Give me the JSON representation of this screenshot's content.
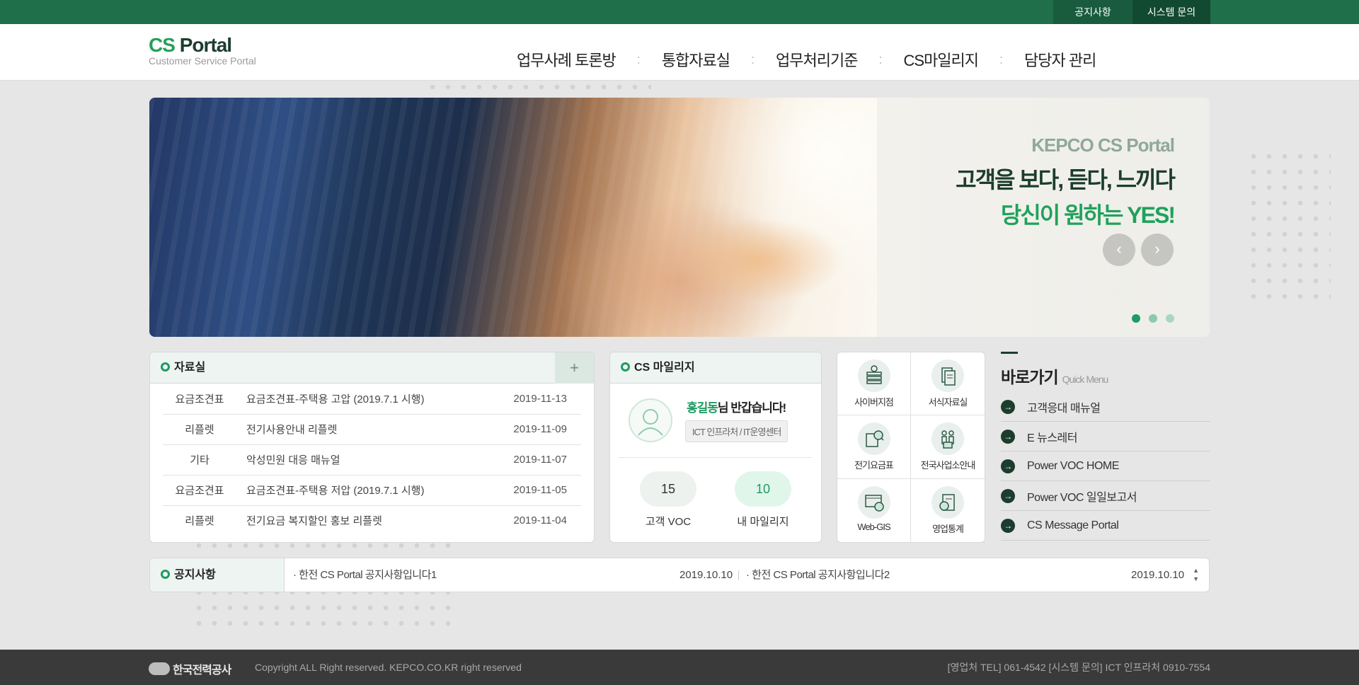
{
  "topbar": {
    "notice_link": "공지사항",
    "system_link": "시스템 문의"
  },
  "header": {
    "logo_cs": "CS",
    "logo_portal": "Portal",
    "logo_sub": "Customer Service Portal",
    "nav": [
      "업무사례 토론방",
      "통합자료실",
      "업무처리기준",
      "CS마일리지",
      "담당자 관리"
    ]
  },
  "hero": {
    "line1": "KEPCO CS Portal",
    "line2": "고객을 보다, 듣다, 느끼다",
    "line3": "당신이 원하는 YES!",
    "slide_count": 3,
    "active_slide": 1
  },
  "library": {
    "title": "자료실",
    "more": "+",
    "rows": [
      {
        "category": "요금조견표",
        "title": "요금조견표-주택용 고압 (2019.7.1 시행)",
        "date": "2019-11-13"
      },
      {
        "category": "리플렛",
        "title": "전기사용안내 리플렛",
        "date": "2019-11-09"
      },
      {
        "category": "기타",
        "title": "악성민원 대응 매뉴얼",
        "date": "2019-11-07"
      },
      {
        "category": "요금조견표",
        "title": "요금조견표-주택용 저압 (2019.7.1 시행)",
        "date": "2019-11-05"
      },
      {
        "category": "리플렛",
        "title": "전기요금 복지할인 홍보 리플렛",
        "date": "2019-11-04"
      }
    ]
  },
  "mileage": {
    "title": "CS 마일리지",
    "user_name": "홍길동",
    "greeting_suffix": "님 반갑습니다!",
    "dept": "ICT 인프라처 / IT운영센터",
    "voc_count": "15",
    "voc_label": "고객 VOC",
    "my_mileage": "10",
    "my_mileage_label": "내 마일리지"
  },
  "shortcuts": [
    {
      "label": "사이버지점",
      "icon": "cyber-branch-icon"
    },
    {
      "label": "서식자료실",
      "icon": "forms-library-icon"
    },
    {
      "label": "전기요금표",
      "icon": "electricity-rate-icon"
    },
    {
      "label": "전국사업소안내",
      "icon": "offices-guide-icon"
    },
    {
      "label": "Web-GIS",
      "icon": "web-gis-icon"
    },
    {
      "label": "영업통계",
      "icon": "sales-statistics-icon"
    }
  ],
  "quick": {
    "title": "바로가기",
    "subtitle": "Quick Menu",
    "items": [
      "고객응대 매뉴얼",
      "E 뉴스레터",
      "Power VOC HOME",
      "Power VOC 일일보고서",
      "CS Message Portal"
    ]
  },
  "notice": {
    "title": "공지사항",
    "items": [
      {
        "text": "· 한전 CS Portal 공지사항입니다1",
        "date": "2019.10.10"
      },
      {
        "text": "· 한전 CS Portal 공지사항입니다2",
        "date": "2019.10.10"
      }
    ]
  },
  "footer": {
    "company": "한국전력공사",
    "copyright": "Copyright ALL Right reserved. KEPCO.CO.KR right reserved",
    "contact": "[영업처 TEL] 061-4542   [시스템 문의] ICT 인프라처 0910-7554"
  }
}
